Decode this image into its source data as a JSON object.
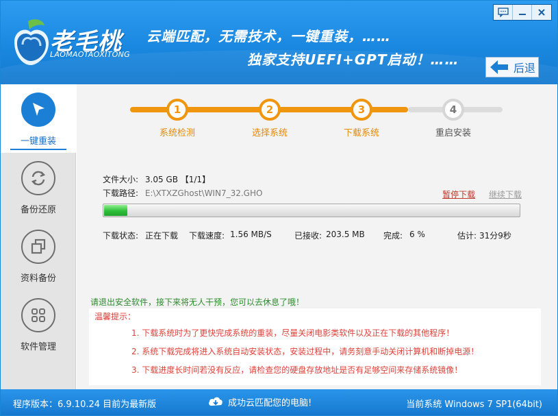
{
  "header": {
    "logo_name": "老毛桃",
    "logo_sub": "LAOMAOTAOXITONG",
    "slogan_line1": "云端匹配，无需技术，一键重装，……",
    "slogan_line2": "独家支持UEFI+GPT启动！……",
    "back_label": "后退"
  },
  "sidebar": {
    "items": [
      {
        "label": "一键重装",
        "icon": "cursor-arrow-icon",
        "active": true
      },
      {
        "label": "备份还原",
        "icon": "refresh-arrows-icon",
        "active": false
      },
      {
        "label": "资料备份",
        "icon": "copy-squares-icon",
        "active": false
      },
      {
        "label": "软件管理",
        "icon": "grid-dots-icon",
        "active": false
      }
    ]
  },
  "steps": [
    {
      "num": "1",
      "label": "系统检测",
      "done": true
    },
    {
      "num": "2",
      "label": "选择系统",
      "done": true
    },
    {
      "num": "3",
      "label": "下载系统",
      "done": true
    },
    {
      "num": "4",
      "label": "重启安装",
      "done": false
    }
  ],
  "download": {
    "size_label": "文件大小:",
    "size_value": "3.05 GB 【1/1】",
    "path_label": "下载路径:",
    "path_value": "E:\\XTXZGhost\\WIN7_32.GHO",
    "pause_label": "暂停下载",
    "continue_label": "继续下载",
    "progress_percent": 6,
    "status_label": "下载状态:",
    "status_value": "正在下载",
    "speed_label": "下载速度:",
    "speed_value": "1.56 MB/S",
    "received_label": "已接收:",
    "received_value": "203.5 MB",
    "done_label": "完成:",
    "done_value": "6 %",
    "eta_label": "估计:",
    "eta_value": "31分9秒"
  },
  "notice": "请退出安全软件，接下来将无人干预，您可以去休息了哦！",
  "tips": {
    "title": "温馨提示：",
    "items": [
      "1. 下载系统时为了更快完成系统的重装，尽量关闭电影类软件以及正在下载的其他程序！",
      "2. 系统下载完成将进入系统自动安装状态，安装过程中，请务刻意手动关闭计算机和断掉电源！",
      "3. 下载进度长时间若没有反应，请检查您的硬盘存放地址是否有足够空间来存储系统镜像！"
    ]
  },
  "footer": {
    "version": "程序版本：6.9.10.24 目前为最新版",
    "cloud_text": "成功云匹配您的电脑!",
    "current_system": "当前系统 Windows 7 SP1(64bit)"
  },
  "colors": {
    "brand_blue": "#1b7fd6",
    "step_orange": "#f0950e",
    "tip_red": "#e0403a",
    "notice_green": "#2e8b2e"
  }
}
